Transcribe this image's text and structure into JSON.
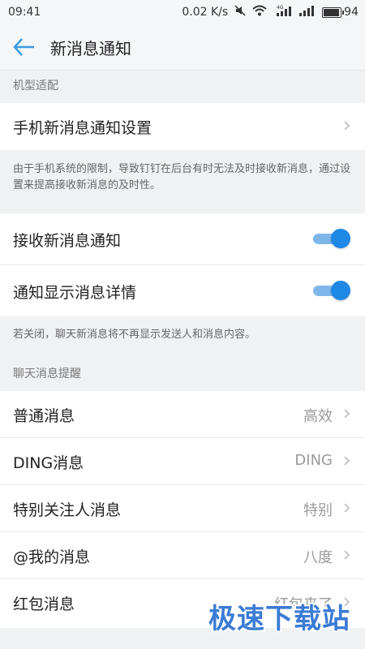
{
  "status_bar": {
    "time": "09:41",
    "network_speed": "0.02 K/s",
    "signal_label": "4G",
    "battery": "94"
  },
  "header": {
    "title": "新消息通知"
  },
  "section_model": {
    "label": "机型适配"
  },
  "phone_settings": {
    "label": "手机新消息通知设置"
  },
  "note_limit": {
    "text": "由于手机系统的限制，导致钉钉在后台有时无法及时接收新消息，通过设置来提高接收新消息的及时性。"
  },
  "receive_notify": {
    "label": "接收新消息通知",
    "enabled": true
  },
  "show_details": {
    "label": "通知显示消息详情",
    "enabled": true
  },
  "note_details": {
    "text": "若关闭，聊天新消息将不再显示发送人和消息内容。"
  },
  "section_chat": {
    "label": "聊天消息提醒"
  },
  "chat_items": [
    {
      "label": "普通消息",
      "value": "高效"
    },
    {
      "label": "DING消息",
      "value": "DING"
    },
    {
      "label": "特别关注人消息",
      "value": "特别"
    },
    {
      "label": "@我的消息",
      "value": "八度"
    },
    {
      "label": "红包消息",
      "value": "红包来了"
    }
  ],
  "watermark": {
    "text": "极速下载站"
  },
  "colors": {
    "accent": "#1e88e5",
    "toggle_track": "#7fb6ea",
    "background": "#f0f1f3"
  }
}
